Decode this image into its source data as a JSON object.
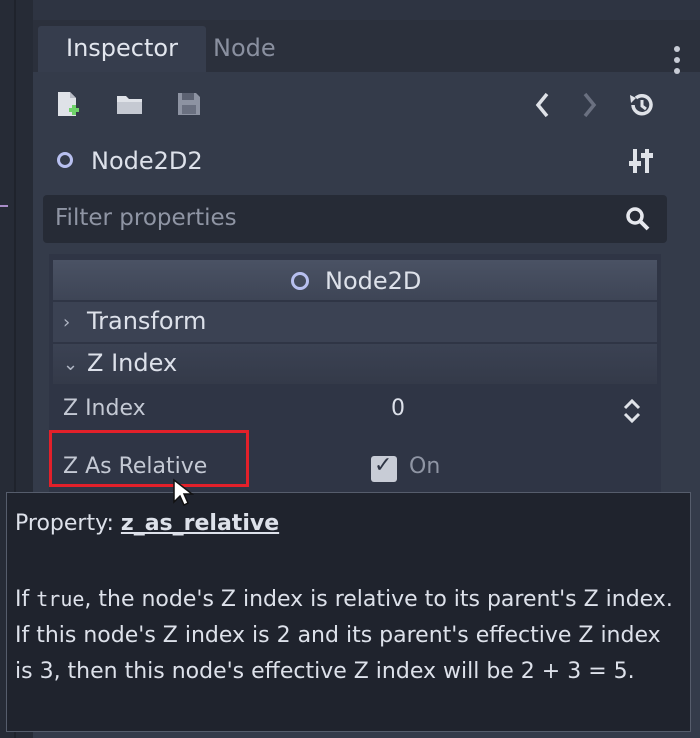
{
  "tabs": [
    {
      "label": "Inspector",
      "active": true
    },
    {
      "label": "Node",
      "active": false
    }
  ],
  "toolbar": {
    "icons": [
      "new-resource-icon",
      "open-folder-icon",
      "save-icon",
      "history-back-icon",
      "history-forward-icon",
      "object-history-icon"
    ]
  },
  "node": {
    "name": "Node2D2",
    "tools_icon": "object-tools-icon"
  },
  "filter": {
    "placeholder": "Filter properties"
  },
  "inspector": {
    "section_title": "Node2D",
    "groups": [
      {
        "label": "Transform",
        "expanded": false
      },
      {
        "label": "Z Index",
        "expanded": true
      }
    ],
    "properties": {
      "z_index": {
        "label": "Z Index",
        "value": "0"
      },
      "z_as_relative": {
        "label": "Z As Relative",
        "checked": true,
        "state_text": "On"
      }
    }
  },
  "tooltip": {
    "prefix": "Property: ",
    "property": "z_as_relative",
    "desc_before_code": "If ",
    "code": "true",
    "desc_after_code": ", the node's Z index is relative to its parent's Z index. If this node's Z index is 2 and its parent's effective Z index is 3, then this node's effective Z index will be 2 + 3 = 5."
  },
  "colors": {
    "highlight_border": "#e3202a",
    "panel_background": "#343b4a",
    "node_icon": "#b8c0f0"
  }
}
